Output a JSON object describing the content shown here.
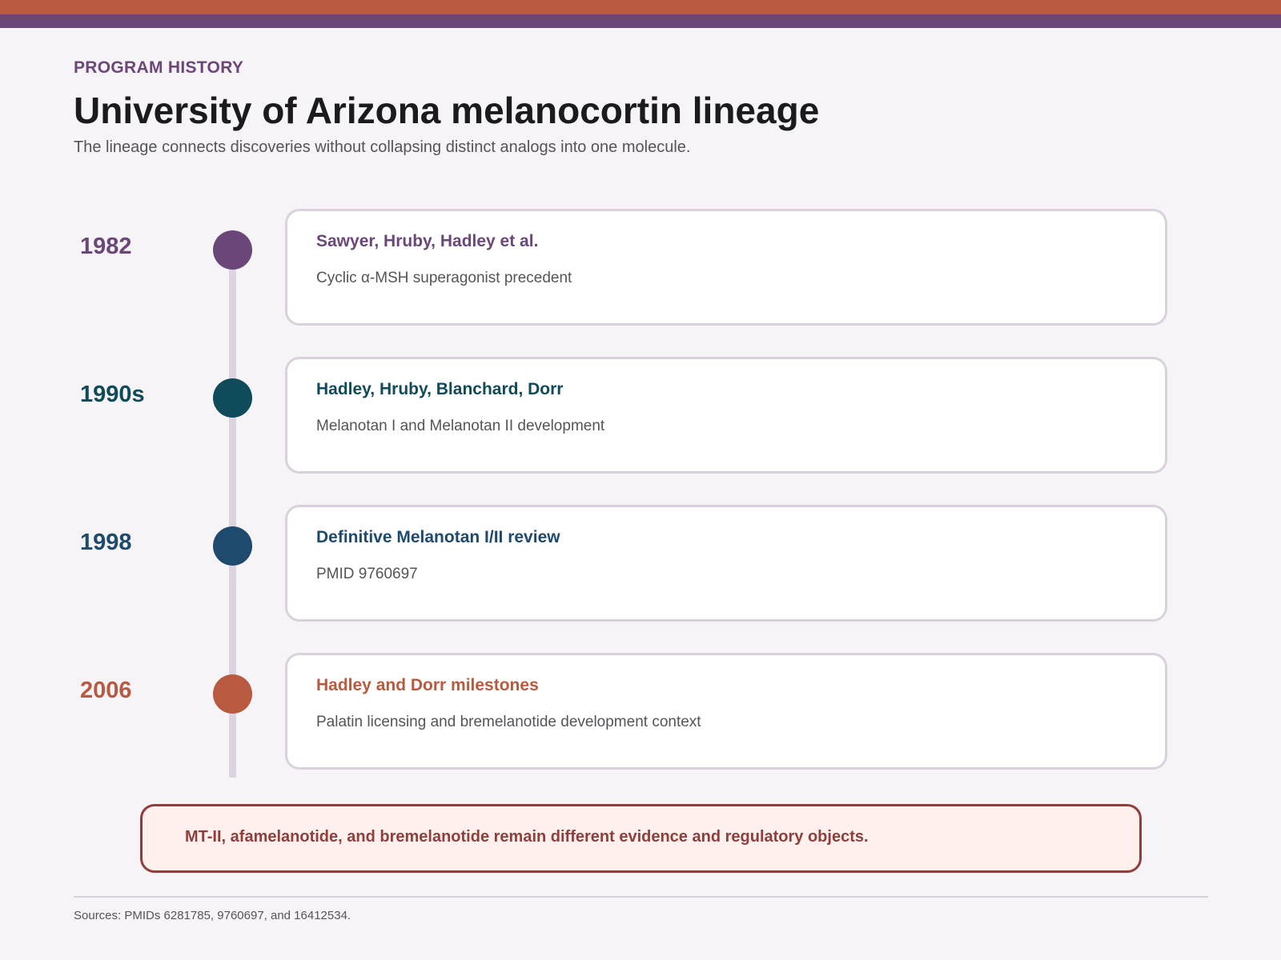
{
  "header": {
    "eyebrow": "PROGRAM HISTORY",
    "title": "University of Arizona melanocortin lineage",
    "subtitle": "The lineage connects discoveries without collapsing distinct analogs into one molecule."
  },
  "timeline": [
    {
      "year": "1982",
      "title": "Sawyer, Hruby, Hadley et al.",
      "description": "Cyclic α-MSH superagonist precedent",
      "color": "#6b4678"
    },
    {
      "year": "1990s",
      "title": "Hadley, Hruby, Blanchard, Dorr",
      "description": "Melanotan I and Melanotan II development",
      "color": "#0f4b5a"
    },
    {
      "year": "1998",
      "title": "Definitive Melanotan I/II review",
      "description": "PMID 9760697",
      "color": "#1e4a6e"
    },
    {
      "year": "2006",
      "title": "Hadley and Dorr milestones",
      "description": "Palatin licensing and bremelanotide development context",
      "color": "#b75a40"
    }
  ],
  "note": {
    "text": "MT-II, afamelanotide, and bremelanotide remain different evidence and regulatory objects."
  },
  "footer": {
    "sources": "Sources: PMIDs 6281785, 9760697, and 16412534."
  },
  "colors": {
    "band_top": "#b75a40",
    "band_bottom": "#6b4678",
    "accent": "#6b4678",
    "note_border": "#8f3e3c",
    "note_fill": "#fff0ee"
  }
}
